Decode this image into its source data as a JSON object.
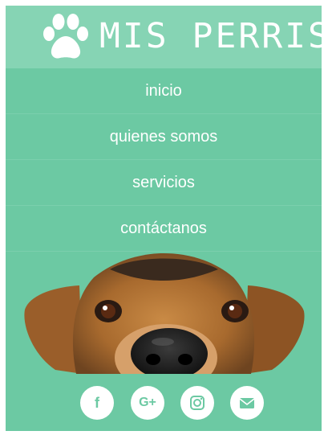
{
  "brand": {
    "title": "MIS PERRIS"
  },
  "nav": [
    {
      "label": "inicio"
    },
    {
      "label": "quienes somos"
    },
    {
      "label": "servicios"
    },
    {
      "label": "contáctanos"
    }
  ],
  "hero": {
    "image": "dog-peeking"
  },
  "social": [
    {
      "icon": "facebook-icon",
      "glyph": "f"
    },
    {
      "icon": "google-plus-icon",
      "glyph": "G+"
    },
    {
      "icon": "instagram-icon",
      "glyph": ""
    },
    {
      "icon": "email-icon",
      "glyph": ""
    }
  ],
  "colors": {
    "primary": "#6cc9a3",
    "header": "#86d4b4",
    "text": "#ffffff"
  }
}
